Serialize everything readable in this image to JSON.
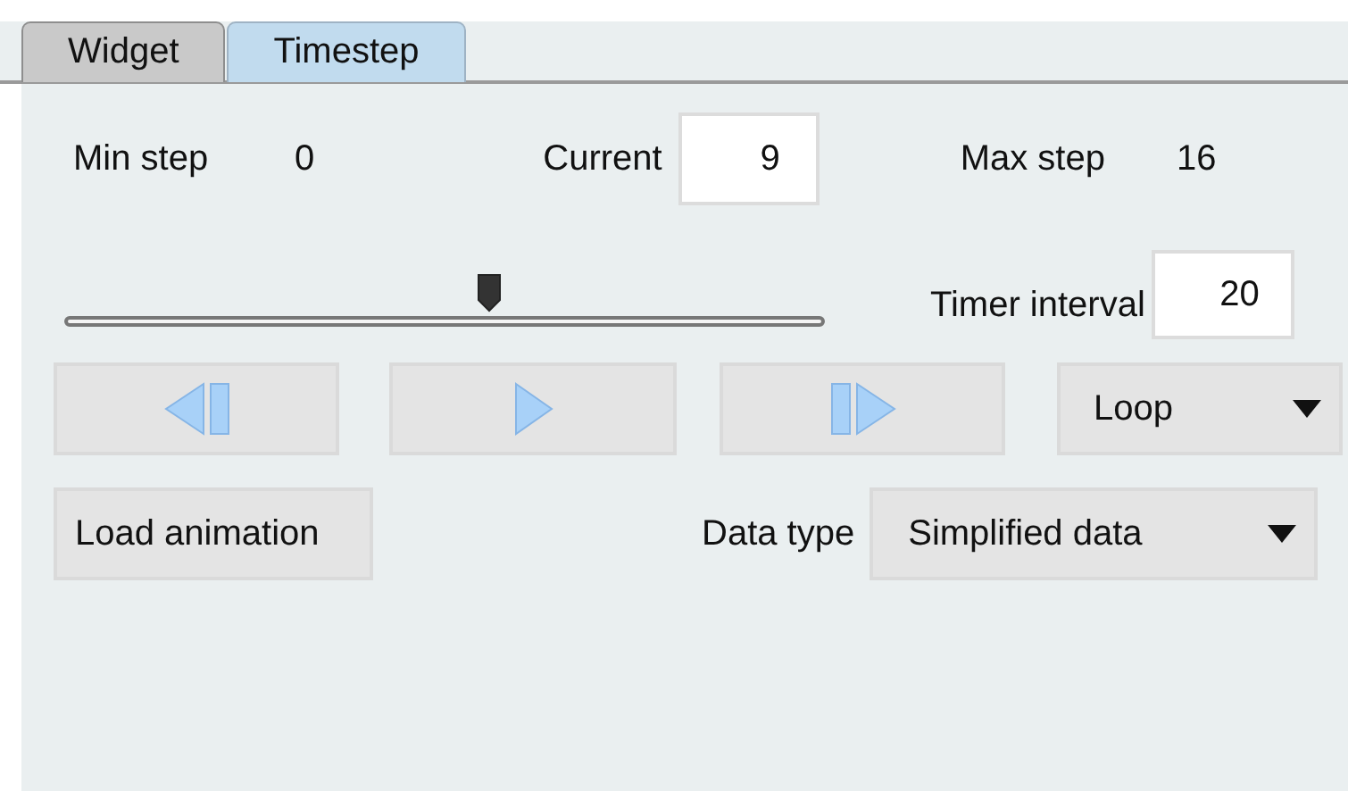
{
  "tabs": [
    {
      "label": "Widget",
      "selected": false
    },
    {
      "label": "Timestep",
      "selected": true
    }
  ],
  "min_step": {
    "label": "Min step",
    "value": "0"
  },
  "current": {
    "label": "Current",
    "value": "9"
  },
  "max_step": {
    "label": "Max step",
    "value": "16"
  },
  "slider": {
    "level": 0.56
  },
  "timer_interval": {
    "label": "Timer interval",
    "value": "20"
  },
  "playback_buttons": [
    {
      "kind": "step_back"
    },
    {
      "kind": "play"
    },
    {
      "kind": "step_forward"
    }
  ],
  "loop_select": {
    "value": "Loop"
  },
  "load_button": {
    "label": "Load animation"
  },
  "data_type": {
    "label": "Data type",
    "value": "Simplified data"
  }
}
